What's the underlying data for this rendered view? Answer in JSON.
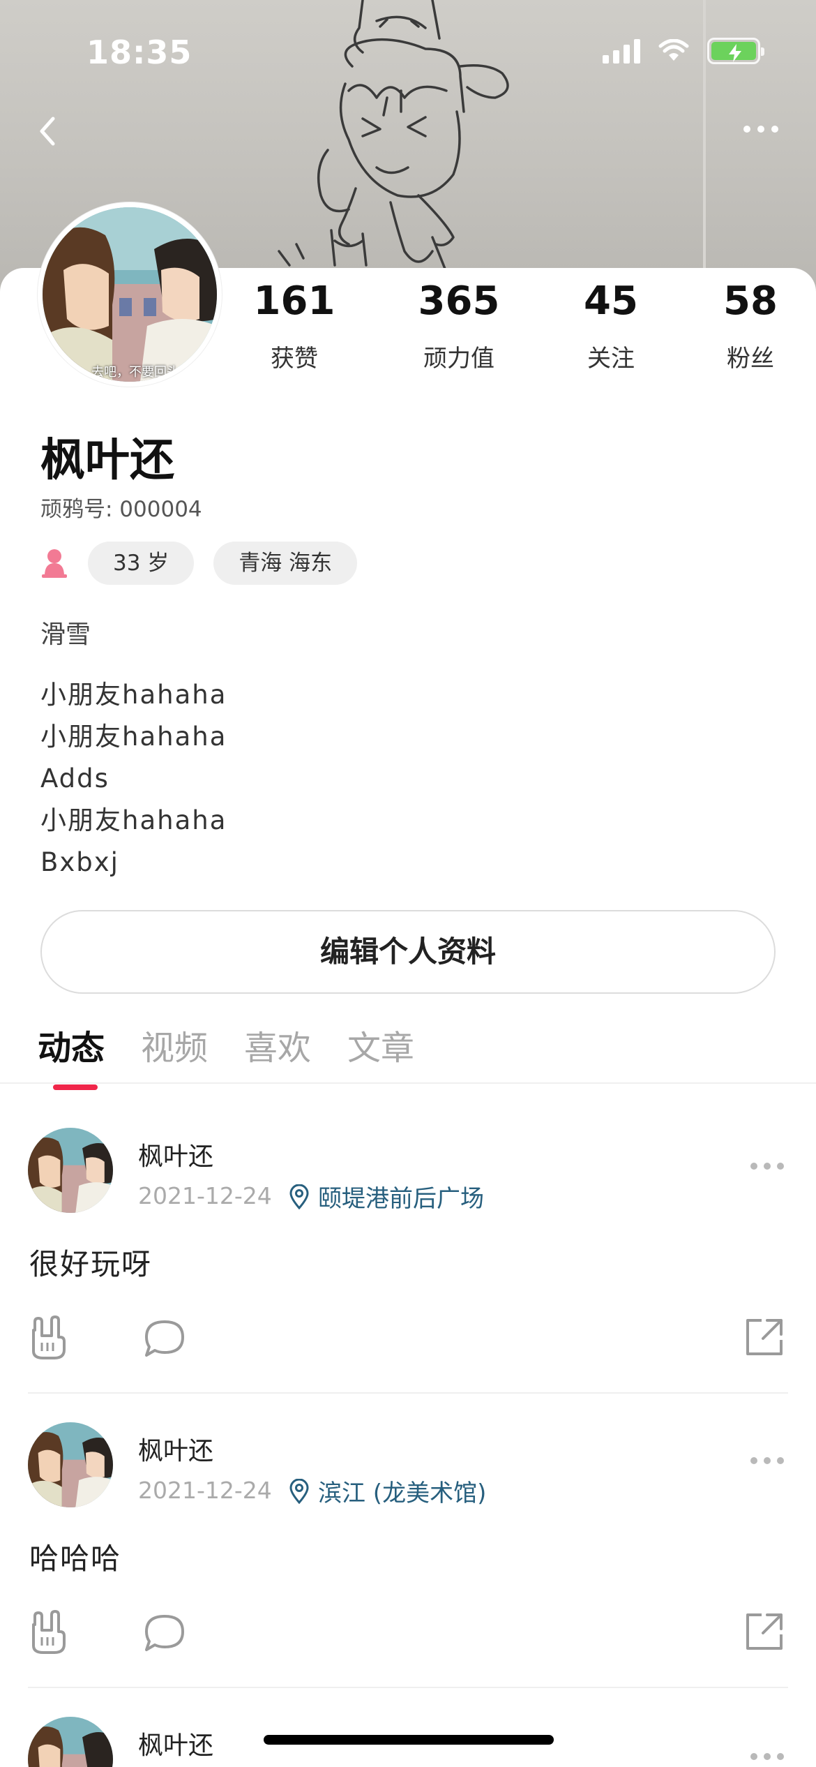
{
  "status_bar": {
    "time": "18:35"
  },
  "header": {
    "back_icon": "chevron-left-icon",
    "more_icon": "more-horizontal-icon"
  },
  "profile": {
    "name": "枫叶还",
    "id_line": "顽鸦号: 000004",
    "stats": [
      {
        "value": "161",
        "label": "获赞"
      },
      {
        "value": "365",
        "label": "顽力值"
      },
      {
        "value": "45",
        "label": "关注"
      },
      {
        "value": "58",
        "label": "粉丝"
      }
    ],
    "gender_icon": "female-icon",
    "age_tag": "33 岁",
    "location_tag": "青海 海东",
    "hobby": "滑雪",
    "bio_lines": [
      "小朋友hahaha",
      "小朋友hahaha",
      "Adds",
      "小朋友hahaha",
      "Bxbxj"
    ],
    "avatar_caption": "去吧，不要回头",
    "edit_button": "编辑个人资料"
  },
  "tabs": [
    {
      "label": "动态",
      "active": true
    },
    {
      "label": "视频",
      "active": false
    },
    {
      "label": "喜欢",
      "active": false
    },
    {
      "label": "文章",
      "active": false
    }
  ],
  "posts": [
    {
      "author": "枫叶还",
      "date": "2021-12-24",
      "location": "颐堤港前后广场",
      "text": "很好玩呀"
    },
    {
      "author": "枫叶还",
      "date": "2021-12-24",
      "location": "滨江 (龙美术馆)",
      "text": "哈哈哈"
    },
    {
      "author": "枫叶还"
    }
  ],
  "colors": {
    "accent": "#f0264a",
    "location": "#275f7e",
    "gender": "#f27a94"
  }
}
